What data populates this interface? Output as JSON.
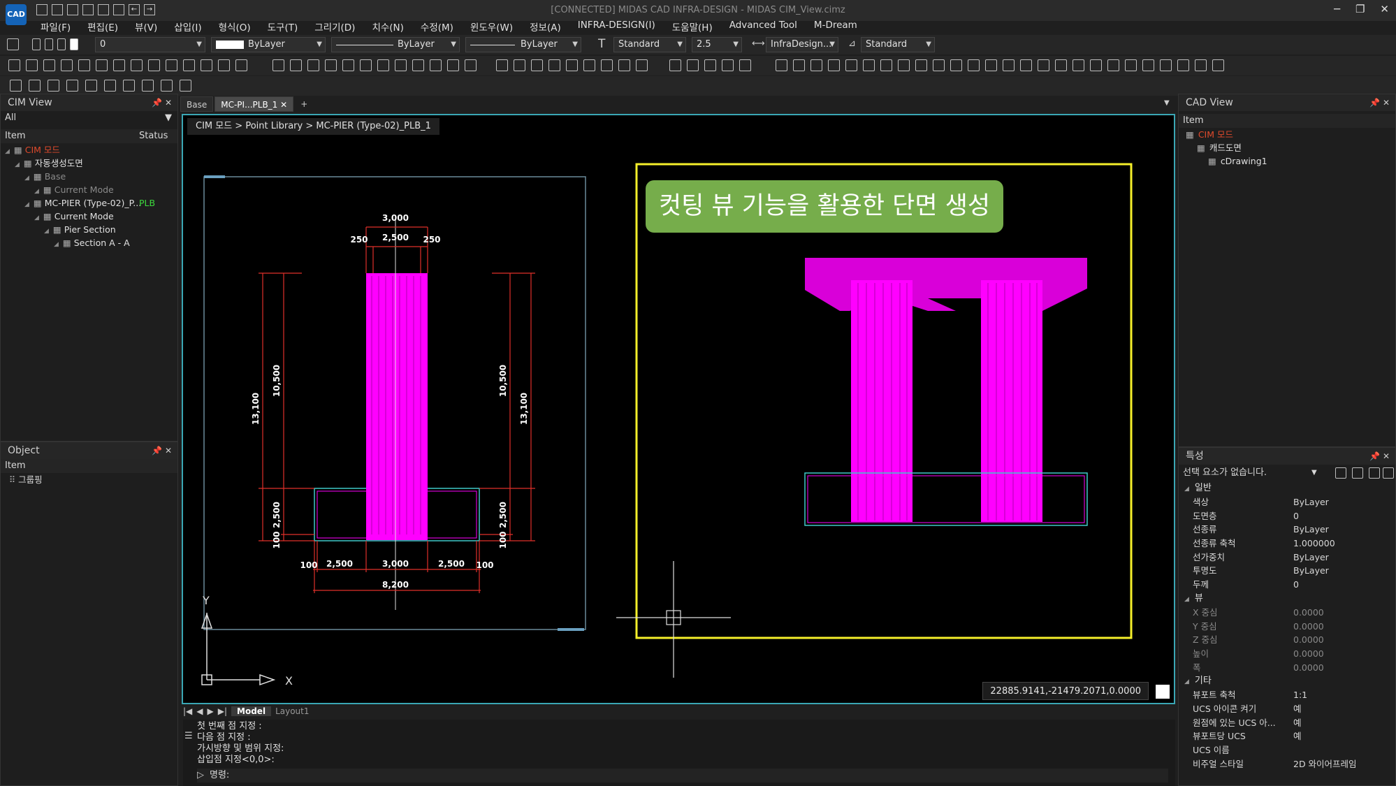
{
  "app": {
    "title": "[CONNECTED] MIDAS CAD INFRA-DESIGN - MIDAS CIM_View.cimz",
    "logo": "CAD"
  },
  "menu": [
    "파일(F)",
    "편집(E)",
    "뷰(V)",
    "삽입(I)",
    "형식(O)",
    "도구(T)",
    "그리기(D)",
    "치수(N)",
    "수정(M)",
    "윈도우(W)",
    "정보(A)",
    "INFRA-DESIGN(I)",
    "도움말(H)",
    "Advanced Tool",
    "M-Dream"
  ],
  "toolbar": {
    "layer": "0",
    "color": "ByLayer",
    "linetype": "ByLayer",
    "lineweight": "ByLayer",
    "textstyle": "Standard",
    "textheight": "2.5",
    "dimstyle": "InfraDesign...",
    "tablestyle": "Standard"
  },
  "cim_view": {
    "title": "CIM View",
    "filter": "All",
    "col_item": "Item",
    "col_status": "Status",
    "rows": [
      {
        "label": "CIM 모드",
        "status": "",
        "color": "#e04a2c",
        "indent": 0
      },
      {
        "label": "자동생성도면",
        "status": "",
        "color": "#e0e0e0",
        "indent": 1
      },
      {
        "label": "Base",
        "status": "",
        "color": "#8a8a8a",
        "indent": 2
      },
      {
        "label": "Current Mode",
        "status": "",
        "color": "#8a8a8a",
        "indent": 3
      },
      {
        "label": "MC-PIER (Type-02)_P...",
        "status": "PLB",
        "color": "#e0e0e0",
        "indent": 2
      },
      {
        "label": "Current Mode",
        "status": "",
        "color": "#e0e0e0",
        "indent": 3
      },
      {
        "label": "Pier Section",
        "status": "",
        "color": "#e0e0e0",
        "indent": 4
      },
      {
        "label": "Section A - A",
        "status": "",
        "color": "#e0e0e0",
        "indent": 5
      }
    ]
  },
  "object_panel": {
    "title": "Object",
    "col_item": "Item",
    "row": "그룹핑"
  },
  "tabs": [
    "Base",
    "MC-PI...PLB_1"
  ],
  "breadcrumb": "CIM 모드 > Point Library > MC-PIER (Type-02)_PLB_1",
  "banner": "컷팅 뷰 기능을 활용한 단면 생성",
  "coord": "22885.9141,-21479.2071,0.0000",
  "dims": {
    "top": "3,000",
    "left_small": "250",
    "mid": "2,500",
    "right_small": "250",
    "h_total": "13,100",
    "h_col": "10,500",
    "h_foot": "2,500",
    "h_base": "100",
    "b1": "100",
    "b2": "2,500",
    "b3": "3,000",
    "b4": "2,500",
    "b5": "100",
    "total": "8,200"
  },
  "axes": {
    "x": "X",
    "y": "Y"
  },
  "layout_tabs": [
    "Model",
    "Layout1"
  ],
  "command": {
    "lines": [
      "첫 번째 점 지정 :",
      "다음 점 지정 :",
      "가시방향 및 범위 지정:",
      "삽입점 지정<0,0>:"
    ],
    "prompt": "명령:"
  },
  "cad_view": {
    "title": "CAD View",
    "col_item": "Item",
    "rows": [
      {
        "label": "CIM 모드",
        "color": "#e04a2c"
      },
      {
        "label": "캐드도면",
        "color": "#e0e0e0"
      },
      {
        "label": "cDrawing1",
        "color": "#e0e0e0"
      }
    ]
  },
  "properties": {
    "title": "특성",
    "selection": "선택 요소가 없습니다.",
    "sections": [
      {
        "name": "일반",
        "rows": [
          [
            "색상",
            "ByLayer"
          ],
          [
            "도면층",
            "0"
          ],
          [
            "선종류",
            "ByLayer"
          ],
          [
            "선종류 축척",
            "1.000000"
          ],
          [
            "선가중치",
            "ByLayer"
          ],
          [
            "투명도",
            "ByLayer"
          ],
          [
            "두께",
            "0"
          ]
        ]
      },
      {
        "name": "뷰",
        "rows": [
          [
            "X 중심",
            "0.0000"
          ],
          [
            "Y 중심",
            "0.0000"
          ],
          [
            "Z 중심",
            "0.0000"
          ],
          [
            "높이",
            "0.0000"
          ],
          [
            "폭",
            "0.0000"
          ]
        ]
      },
      {
        "name": "기타",
        "rows": [
          [
            "뷰포트 축척",
            "1:1"
          ],
          [
            "UCS 아이콘 켜기",
            "예"
          ],
          [
            "원점에 있는 UCS 아...",
            "예"
          ],
          [
            "뷰포트당 UCS",
            "예"
          ],
          [
            "UCS 이름",
            ""
          ],
          [
            "비주얼 스타일",
            "2D 와이어프레임"
          ]
        ]
      }
    ]
  },
  "colors": {
    "accent": "#3aa6b4",
    "magenta": "#ff00ff",
    "red": "#e0302a",
    "yellow": "#f5ef2a",
    "cyan": "#3fc8c8",
    "banner": "#76ad4b"
  }
}
